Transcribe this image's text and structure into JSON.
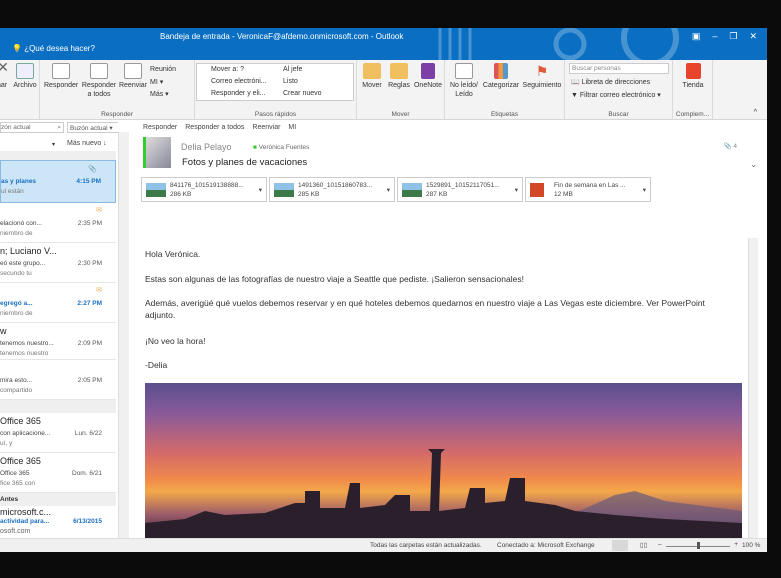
{
  "titlebar": {
    "title": "Bandeja de entrada - VeronicaF@afdemo.onmicrosoft.com - Outlook",
    "tell_me": "¿Qué desea hacer?"
  },
  "ribbon": {
    "nar": "nar",
    "archive": "Archivo",
    "reply": "Responder",
    "reply_all": "Responder a todos",
    "forward": "Reenviar",
    "meeting": "Reunión",
    "im": "MI ▾",
    "more": "Más ▾",
    "respond_group": "Responder",
    "quick_steps": [
      "Mover a: ?",
      "Correo electróni...",
      "Responder y eli...",
      "Al jefe",
      "Listo",
      "Crear nuevo"
    ],
    "quick_group": "Pasos rápidos",
    "move": "Mover",
    "rules": "Reglas",
    "onenote": "OneNote",
    "move_group": "Mover",
    "unread": "No leído/ Leído",
    "categorize": "Categorizar",
    "followup": "Seguimiento",
    "tags_group": "Etiquetas",
    "search_people_placeholder": "Buscar personas",
    "address_book": "Libreta de direcciones",
    "filter_email": "Filtrar correo electrónico ▾",
    "find_group": "Buscar",
    "store": "Tienda",
    "addins_group": "Complem..."
  },
  "list": {
    "search_placeholder": "zón actual",
    "scope": "Buzón actual",
    "sort": "Más nuevo ↓",
    "items": [
      {
        "a": "",
        "b": "as y planes",
        "c": "ul están",
        "t": "4:15 PM"
      },
      {
        "a": "",
        "b": "elacionó con...",
        "c": "niembro de",
        "t": "2:35 PM"
      },
      {
        "a": "n;  Luciano V...",
        "b": "eó este grupo...",
        "c": "secundo tu",
        "t": "2:30 PM"
      },
      {
        "a": "",
        "b": "egregó a...",
        "c": "niembro de",
        "t": "2:27 PM"
      },
      {
        "a": "w",
        "b": "tenemos nuestro...",
        "c": "tenemos nuestro",
        "t": "2:09 PM"
      },
      {
        "a": "",
        "b": "mira esto...",
        "c": "compartido",
        "t": "2:05 PM"
      },
      {
        "a": "Office 365",
        "b": "con aplicacione...",
        "c": "uí, y",
        "t": "Lun. 6/22"
      },
      {
        "a": "Office 365",
        "b": "Office 365",
        "c": "fice 365 con",
        "t": "Dom. 6/21"
      },
      {
        "a": "microsoft.c...",
        "b": "actividad para...",
        "c": "osoft.com",
        "t": "6/13/2015"
      }
    ],
    "older_header": "Antes"
  },
  "reading": {
    "actions": [
      "Responder",
      "Responder a todos",
      "Reenviar",
      "MI"
    ],
    "sender": "Delia Pelayo",
    "recipient": "Verónica Fuentes",
    "subject": "Fotos y planes de vacaciones",
    "people_count": "4",
    "attachments": [
      {
        "name": "841176_101519138888...",
        "size": "286 KB"
      },
      {
        "name": "1491360_10151860783...",
        "size": "285 KB"
      },
      {
        "name": "1529891_10152117051...",
        "size": "287 KB"
      },
      {
        "name": "Fin de semana en Las ...",
        "size": "12 MB"
      }
    ],
    "body": [
      "Hola Verónica.",
      "Estas son algunas de las fotografías de nuestro viaje a Seattle que pediste. ¡Salieron sensacionales!",
      "Además, averigüé qué vuelos debemos reservar y en qué hoteles debemos quedarnos en nuestro viaje a Las Vegas este diciembre. Ver PowerPoint adjunto.",
      "¡No veo la hora!",
      "-Delia"
    ]
  },
  "status": {
    "left": "Todas las carpetas están actualizadas.",
    "connection": "Conectado a: Microsoft Exchange",
    "zoom": "100 %",
    "zoom_value": 100
  },
  "colors": {
    "accent": "#0a6fc2",
    "selected": "#cde6f7"
  }
}
